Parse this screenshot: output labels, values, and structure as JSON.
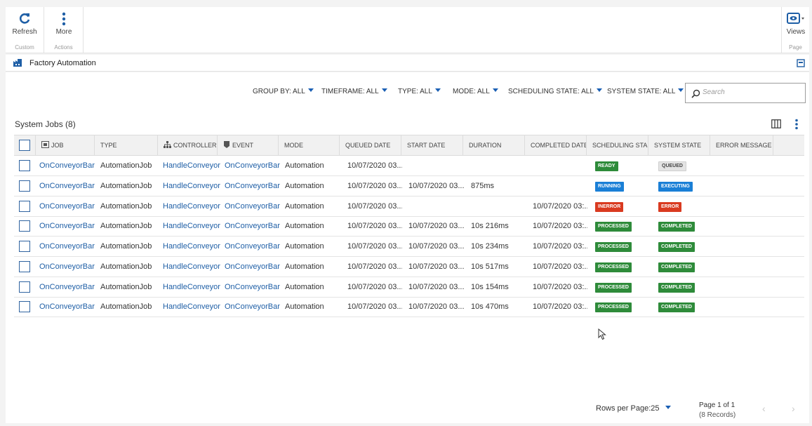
{
  "ribbon": {
    "refresh_label": "Refresh",
    "more_label": "More",
    "custom_group": "Custom",
    "actions_group": "Actions",
    "views_label": "Views",
    "page_group": "Page"
  },
  "context": {
    "title": "Factory Automation"
  },
  "filters": [
    {
      "label": "GROUP BY: ALL"
    },
    {
      "label": "TIMEFRAME: ALL"
    },
    {
      "label": "TYPE: ALL"
    },
    {
      "label": "MODE: ALL"
    },
    {
      "label": "SCHEDULING STATE: ALL"
    },
    {
      "label": "SYSTEM STATE: ALL"
    }
  ],
  "search": {
    "placeholder": "Search"
  },
  "section": {
    "title": "System Jobs (8)"
  },
  "table": {
    "columns": [
      "JOB",
      "TYPE",
      "CONTROLLER",
      "EVENT",
      "MODE",
      "QUEUED DATE",
      "START DATE",
      "DURATION",
      "COMPLETED DATE",
      "SCHEDULING STA...",
      "SYSTEM STATE",
      "ERROR MESSAGE"
    ],
    "rows": [
      {
        "job": "OnConveyorBar",
        "type": "AutomationJob",
        "controller": "HandleConveyor",
        "event": "OnConveyorBar",
        "mode": "Automation",
        "queued": "10/07/2020 03...",
        "start": "",
        "duration": "",
        "completed": "",
        "sched": "READY",
        "system": "QUEUED",
        "error": ""
      },
      {
        "job": "OnConveyorBar",
        "type": "AutomationJob",
        "controller": "HandleConveyor",
        "event": "OnConveyorBar",
        "mode": "Automation",
        "queued": "10/07/2020 03...",
        "start": "10/07/2020 03...",
        "duration": "875ms",
        "completed": "",
        "sched": "RUNNING",
        "system": "EXECUTING",
        "error": ""
      },
      {
        "job": "OnConveyorBar",
        "type": "AutomationJob",
        "controller": "HandleConveyor",
        "event": "OnConveyorBar",
        "mode": "Automation",
        "queued": "10/07/2020 03...",
        "start": "",
        "duration": "",
        "completed": "10/07/2020 03:...",
        "sched": "INERROR",
        "system": "ERROR",
        "error": ""
      },
      {
        "job": "OnConveyorBar",
        "type": "AutomationJob",
        "controller": "HandleConveyor",
        "event": "OnConveyorBar",
        "mode": "Automation",
        "queued": "10/07/2020 03...",
        "start": "10/07/2020 03...",
        "duration": "10s 216ms",
        "completed": "10/07/2020 03:...",
        "sched": "PROCESSED",
        "system": "COMPLETED",
        "error": ""
      },
      {
        "job": "OnConveyorBar",
        "type": "AutomationJob",
        "controller": "HandleConveyor",
        "event": "OnConveyorBar",
        "mode": "Automation",
        "queued": "10/07/2020 03...",
        "start": "10/07/2020 03...",
        "duration": "10s 234ms",
        "completed": "10/07/2020 03:...",
        "sched": "PROCESSED",
        "system": "COMPLETED",
        "error": ""
      },
      {
        "job": "OnConveyorBar",
        "type": "AutomationJob",
        "controller": "HandleConveyor",
        "event": "OnConveyorBar",
        "mode": "Automation",
        "queued": "10/07/2020 03...",
        "start": "10/07/2020 03...",
        "duration": "10s 517ms",
        "completed": "10/07/2020 03:...",
        "sched": "PROCESSED",
        "system": "COMPLETED",
        "error": ""
      },
      {
        "job": "OnConveyorBar",
        "type": "AutomationJob",
        "controller": "HandleConveyor",
        "event": "OnConveyorBar",
        "mode": "Automation",
        "queued": "10/07/2020 03...",
        "start": "10/07/2020 03...",
        "duration": "10s 154ms",
        "completed": "10/07/2020 03:...",
        "sched": "PROCESSED",
        "system": "COMPLETED",
        "error": ""
      },
      {
        "job": "OnConveyorBar",
        "type": "AutomationJob",
        "controller": "HandleConveyor",
        "event": "OnConveyorBar",
        "mode": "Automation",
        "queued": "10/07/2020 03...",
        "start": "10/07/2020 03...",
        "duration": "10s 470ms",
        "completed": "10/07/2020 03:...",
        "sched": "PROCESSED",
        "system": "COMPLETED",
        "error": ""
      }
    ]
  },
  "state_colors": {
    "READY": "#2e8b3a",
    "RUNNING": "#1a7fd6",
    "INERROR": "#d93a20",
    "PROCESSED": "#2e8b3a",
    "QUEUED": "#e4e4e4",
    "EXECUTING": "#1a7fd6",
    "ERROR": "#d93a20",
    "COMPLETED": "#2e8b3a"
  },
  "footer": {
    "rows_per_page": "Rows per Page:25",
    "page": "Page 1 of 1",
    "records": "(8 Records)"
  },
  "icons": [
    "refresh-icon",
    "more-vertical-icon",
    "views-eye-icon",
    "factory-icon",
    "panel-toggle-icon",
    "search-icon",
    "column-chooser-icon",
    "kebab-menu-icon",
    "job-icon",
    "controller-icon",
    "event-icon",
    "chevron-left-icon",
    "chevron-right-icon",
    "mouse-cursor-icon"
  ]
}
